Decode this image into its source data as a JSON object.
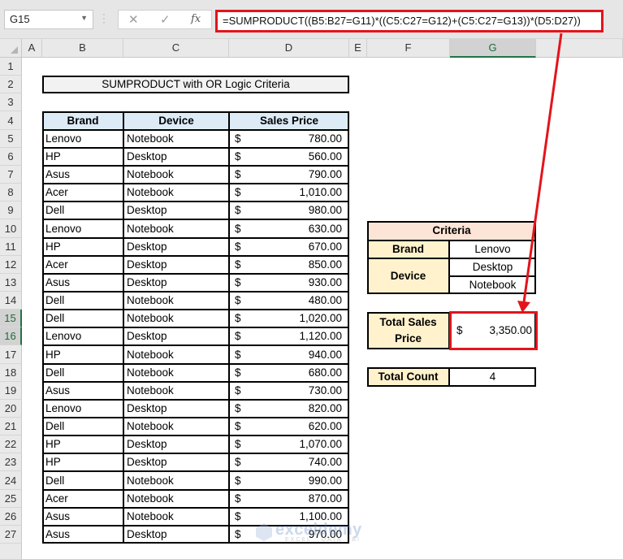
{
  "formula_bar": {
    "name_box": "G15",
    "cancel_icon": "✕",
    "enter_icon": "✓",
    "fx_label": "fx",
    "formula": "=SUMPRODUCT((B5:B27=G11)*((C5:C27=G12)+(C5:C27=G13))*(D5:D27))"
  },
  "columns": [
    "A",
    "B",
    "C",
    "D",
    "E",
    "F",
    "G"
  ],
  "selected_column": "G",
  "rows": [
    "1",
    "2",
    "3",
    "4",
    "5",
    "6",
    "7",
    "8",
    "9",
    "10",
    "11",
    "12",
    "13",
    "14",
    "15",
    "16",
    "17",
    "18",
    "19",
    "20",
    "21",
    "22",
    "23",
    "24",
    "25",
    "26",
    "27"
  ],
  "selected_rows": [
    "15",
    "16"
  ],
  "title": "SUMPRODUCT with OR Logic Criteria",
  "table": {
    "headers": [
      "Brand",
      "Device",
      "Sales Price"
    ],
    "currency_symbol": "$",
    "rows": [
      {
        "brand": "Lenovo",
        "device": "Notebook",
        "price": "780.00"
      },
      {
        "brand": "HP",
        "device": "Desktop",
        "price": "560.00"
      },
      {
        "brand": "Asus",
        "device": "Notebook",
        "price": "790.00"
      },
      {
        "brand": "Acer",
        "device": "Notebook",
        "price": "1,010.00"
      },
      {
        "brand": "Dell",
        "device": "Desktop",
        "price": "980.00"
      },
      {
        "brand": "Lenovo",
        "device": "Notebook",
        "price": "630.00"
      },
      {
        "brand": "HP",
        "device": "Desktop",
        "price": "670.00"
      },
      {
        "brand": "Acer",
        "device": "Desktop",
        "price": "850.00"
      },
      {
        "brand": "Asus",
        "device": "Desktop",
        "price": "930.00"
      },
      {
        "brand": "Dell",
        "device": "Notebook",
        "price": "480.00"
      },
      {
        "brand": "Dell",
        "device": "Notebook",
        "price": "1,020.00"
      },
      {
        "brand": "Lenovo",
        "device": "Desktop",
        "price": "1,120.00"
      },
      {
        "brand": "HP",
        "device": "Notebook",
        "price": "940.00"
      },
      {
        "brand": "Dell",
        "device": "Notebook",
        "price": "680.00"
      },
      {
        "brand": "Asus",
        "device": "Notebook",
        "price": "730.00"
      },
      {
        "brand": "Lenovo",
        "device": "Desktop",
        "price": "820.00"
      },
      {
        "brand": "Dell",
        "device": "Notebook",
        "price": "620.00"
      },
      {
        "brand": "HP",
        "device": "Desktop",
        "price": "1,070.00"
      },
      {
        "brand": "HP",
        "device": "Desktop",
        "price": "740.00"
      },
      {
        "brand": "Dell",
        "device": "Notebook",
        "price": "990.00"
      },
      {
        "brand": "Acer",
        "device": "Notebook",
        "price": "870.00"
      },
      {
        "brand": "Asus",
        "device": "Notebook",
        "price": "1,100.00"
      },
      {
        "brand": "Asus",
        "device": "Desktop",
        "price": "970.00"
      }
    ]
  },
  "criteria": {
    "header": "Criteria",
    "brand_label": "Brand",
    "brand_value": "Lenovo",
    "device_label": "Device",
    "device_values": [
      "Desktop",
      "Notebook"
    ]
  },
  "result": {
    "label": "Total Sales Price",
    "currency_symbol": "$",
    "value": "3,350.00"
  },
  "count": {
    "label": "Total Count",
    "value": "4"
  },
  "watermark": {
    "brand": "exceldemy",
    "tagline": "EXCEL · DATA · BI"
  },
  "colors": {
    "highlight_red": "#e3141b",
    "table_header_fill": "#ddebf7",
    "criteria_header_fill": "#fce4d6",
    "criteria_label_fill": "#fff2cc",
    "title_fill": "#f2f2f2",
    "excel_green": "#217346"
  }
}
